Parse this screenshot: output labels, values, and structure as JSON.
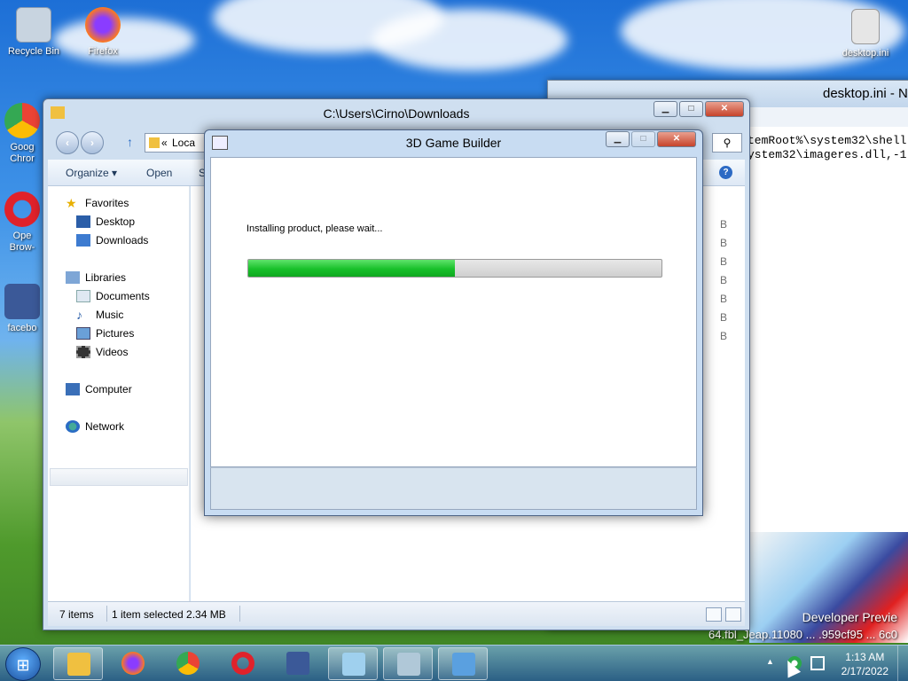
{
  "desktop": {
    "icons": [
      {
        "label": "Recycle Bin",
        "icon": "recycle-bin-icon",
        "color": "#c8d4e0"
      },
      {
        "label": "Firefox",
        "icon": "firefox-icon",
        "color": "#ff7a1a"
      },
      {
        "label": "Goog\nChror",
        "icon": "chrome-icon",
        "color": "#34a853"
      },
      {
        "label": "Ope\nBrow-",
        "icon": "opera-icon",
        "color": "#e0222b"
      },
      {
        "label": "facebo",
        "icon": "facebook-icon",
        "color": "#3b5998"
      },
      {
        "label": "desktop.ini",
        "icon": "ini-file-icon",
        "color": "#e6e6e6"
      }
    ],
    "developer_preview": "Developer Previe",
    "build_string": "64.fbl_Jeap.11080 ... .959cf95 ... 6c0"
  },
  "notepad": {
    "title": "desktop.ini - N",
    "lines": [
      "temRoot%\\system32\\shell",
      "ystem32\\imageres.dll,-1"
    ]
  },
  "explorer": {
    "title": "C:\\Users\\Cirno\\Downloads",
    "address_chevron": "«",
    "address_text": "Loca",
    "commands": {
      "organize": "Organize ▾",
      "open": "Open",
      "share": "S"
    },
    "nav": {
      "favorites": "Favorites",
      "desktop": "Desktop",
      "downloads": "Downloads",
      "libraries": "Libraries",
      "documents": "Documents",
      "music": "Music",
      "pictures": "Pictures",
      "videos": "Videos",
      "computer": "Computer",
      "network": "Network"
    },
    "size_fragments": [
      "B",
      "B",
      "B",
      "B",
      "B",
      "B",
      "B"
    ],
    "status": {
      "items": "7 items",
      "selected": "1 item selected  2.34 MB"
    }
  },
  "installer": {
    "title": "3D Game Builder",
    "message": "Installing product, please wait...",
    "progress": 0.5
  },
  "taskbar": {
    "start_glyph": "⊞",
    "apps": [
      {
        "name": "explorer",
        "icon": "folder-icon",
        "color": "#f0c040",
        "active": true
      },
      {
        "name": "firefox",
        "icon": "firefox-icon",
        "color": "#ff7a1a",
        "active": false
      },
      {
        "name": "chrome",
        "icon": "chrome-icon",
        "color": "#34a853",
        "active": false
      },
      {
        "name": "opera",
        "icon": "opera-icon",
        "color": "#e0222b",
        "active": false
      },
      {
        "name": "facebook",
        "icon": "facebook-icon",
        "color": "#3b5998",
        "active": false
      },
      {
        "name": "notepad",
        "icon": "notepad-icon",
        "color": "#9fd0ee",
        "active": true
      },
      {
        "name": "task-manager",
        "icon": "task-manager-icon",
        "color": "#b0c8d8",
        "active": true
      },
      {
        "name": "installer",
        "icon": "installer-icon",
        "color": "#5aa0e0",
        "active": true
      }
    ],
    "time": "1:13 AM",
    "date": "2/17/2022",
    "tray_arrow": "▲"
  }
}
